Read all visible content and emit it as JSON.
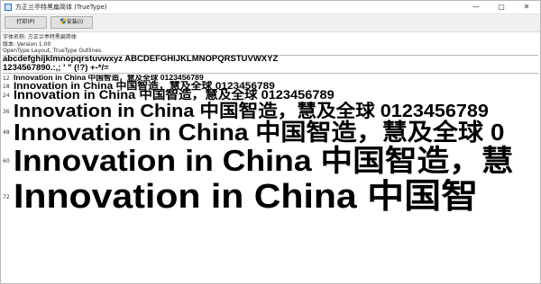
{
  "window": {
    "title": "方正兰亭特黑扁简体 (TrueType)",
    "minimize_icon": "minimize-icon",
    "maximize_icon": "maximize-icon",
    "close_icon": "close-icon"
  },
  "toolbar": {
    "print_label": "打印(P)",
    "install_label": "安装(I)"
  },
  "info": {
    "font_name": "字体名称: 方正兰亭特黑扁简体",
    "version": "版本: Version 1.00",
    "outlines": "OpenType Layout, TrueType Outlines"
  },
  "charset": {
    "line1": "abcdefghijklmnopqrstuvwxyz ABCDEFGHIJKLMNOPQRSTUVWXYZ",
    "line2": "1234567890.:,; ' \" (!?) +-*/="
  },
  "samples": [
    {
      "size": "12",
      "text": "Innovation in China 中国智造，慧及全球 0123456789"
    },
    {
      "size": "18",
      "text": "Innovation in China 中国智造，慧及全球 0123456789"
    },
    {
      "size": "24",
      "text": "Innovation in China 中国智造，慧及全球 0123456789"
    },
    {
      "size": "36",
      "text": "Innovation in China 中国智造，慧及全球 0123456789"
    },
    {
      "size": "48",
      "text": "Innovation in China 中国智造，慧及全球 0"
    },
    {
      "size": "60",
      "text": "Innovation in China 中国智造，慧"
    },
    {
      "size": "72",
      "text": "Innovation in China 中国智"
    }
  ]
}
